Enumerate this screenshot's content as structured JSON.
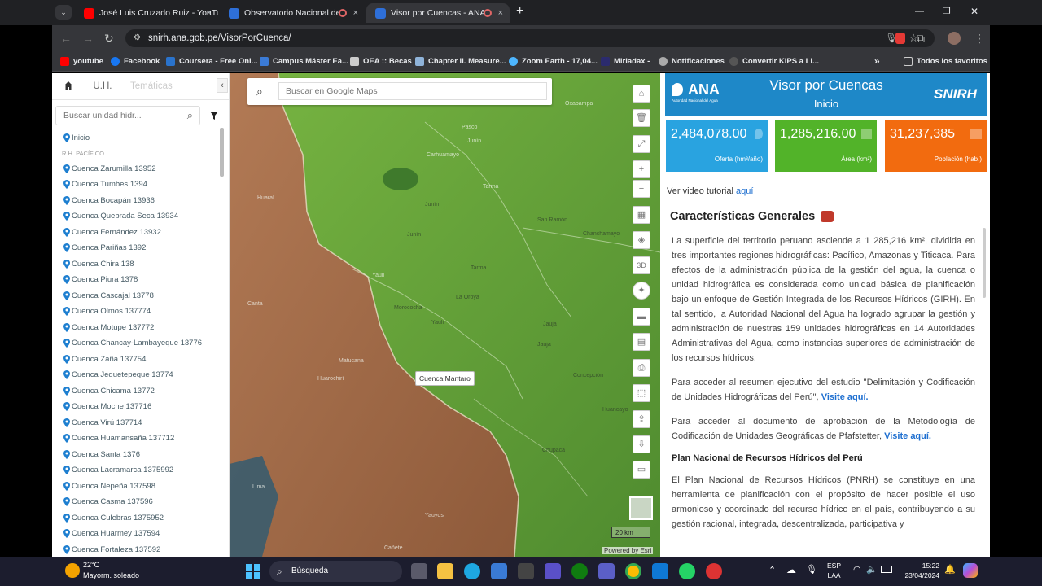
{
  "browser": {
    "tabs": [
      {
        "title": "José Luis Cruzado Ruiz - YouTu",
        "close": "×"
      },
      {
        "title": "Observatorio Nacional de",
        "close": "×"
      },
      {
        "title": "Visor por Cuencas - ANA",
        "close": "×"
      }
    ],
    "new_tab": "+",
    "window_controls": {
      "minimize": "—",
      "restore": "❐",
      "close": "✕"
    },
    "url": "snirh.ana.gob.pe/VisorPorCuenca/",
    "bookmarks": [
      {
        "label": "youtube",
        "color": "#ff0000"
      },
      {
        "label": "Facebook",
        "color": "#1877f2"
      },
      {
        "label": "Coursera - Free Onl...",
        "color": "#2a73cc"
      },
      {
        "label": "Campus Máster Ea...",
        "color": "#3b7bd6"
      },
      {
        "label": "OEA :: Becas",
        "color": "#cccccc"
      },
      {
        "label": "Chapter II. Measure...",
        "color": "#8fb3d9"
      },
      {
        "label": "Zoom Earth - 17,04...",
        "color": "#4db6ff"
      },
      {
        "label": "Miriadax -",
        "color": "#2b2b6e"
      },
      {
        "label": "Notificaciones",
        "color": "#aaaaaa"
      },
      {
        "label": "Convertir KIPS a Li...",
        "color": "#333333"
      }
    ],
    "more_bookmarks": "»",
    "all_favorites": "Todos los favoritos"
  },
  "left_panel": {
    "tab_uh": "U.H.",
    "tab_tematicas": "Temáticas",
    "collapse": "‹",
    "search_placeholder": "Buscar unidad hidr...",
    "start": "Inicio",
    "section": "R.H. PACÍFICO",
    "items": [
      "Cuenca Zarumilla 13952",
      "Cuenca Tumbes 1394",
      "Cuenca Bocapán 13936",
      "Cuenca Quebrada Seca 13934",
      "Cuenca Fernández 13932",
      "Cuenca Pariñas 1392",
      "Cuenca Chira 138",
      "Cuenca Piura 1378",
      "Cuenca Cascajal 13778",
      "Cuenca Olmos 137774",
      "Cuenca Motupe 137772",
      "Cuenca Chancay-Lambayeque 13776",
      "Cuenca Zaña 137754",
      "Cuenca Jequetepeque 13774",
      "Cuenca Chicama 13772",
      "Cuenca Moche 137716",
      "Cuenca Virú 137714",
      "Cuenca Huamansaña 137712",
      "Cuenca Santa 1376",
      "Cuenca Lacramarca 1375992",
      "Cuenca Nepeña 137598",
      "Cuenca Casma 137596",
      "Cuenca Culebras 1375952",
      "Cuenca Huarmey 137594",
      "Cuenca Fortaleza 137592"
    ]
  },
  "map": {
    "search_placeholder": "Buscar en Google Maps",
    "tooltip": "Cuenca Mantaro",
    "scale": "20 km",
    "attribution": "Powered by Esri",
    "tool_3d": "3D",
    "labels": [
      "Oxapampa",
      "Pasco",
      "Junín",
      "Carhuamayo",
      "Junín",
      "Junín",
      "Tarma",
      "Tarma",
      "San Ramón",
      "Chanchamayo",
      "Yauli",
      "Morococha",
      "La Oroya",
      "Yauli",
      "Jauja",
      "Jauja",
      "Matucana",
      "Huarochirí",
      "Concepción",
      "Huancayo",
      "Chupaca",
      "Huaral",
      "Canta",
      "Yauyos",
      "Cañete",
      "Lima"
    ]
  },
  "right_panel": {
    "logo_ana": "ANA",
    "logo_ana_sub": "Autoridad Nacional del Agua",
    "title": "Visor por Cuencas",
    "subtitle": "Inicio",
    "logo_snirh": "SNIRH",
    "stats": [
      {
        "value": "2,484,078.00",
        "label": "Oferta (hm³/año)",
        "color": "#29a3e0"
      },
      {
        "value": "1,285,216.00",
        "label": "Área (km²)",
        "color": "#52b329"
      },
      {
        "value": "31,237,385",
        "label": "Población (hab.)",
        "color": "#f26b0f"
      }
    ],
    "video_text": "Ver video tutorial",
    "video_link": "aquí",
    "section_title": "Características Generales",
    "p1": "La superficie del territorio peruano asciende a 1 285,216 km², dividida en tres importantes regiones hidrográficas: Pacífico, Amazonas y Titicaca. Para efectos de la administración pública de la gestión del agua, la cuenca o unidad hidrográfica es considerada como unidad básica de planificación bajo un enfoque de Gestión Integrada de los Recursos Hídricos (GIRH). En tal sentido, la Autoridad Nacional del Agua ha logrado agrupar la gestión y administración de nuestras 159 unidades hidrográficas en 14 Autoridades Administrativas del Agua, como instancias superiores de administración de los recursos hídricos.",
    "p2": "Para acceder al resumen ejecutivo del estudio \"Delimitación y Codificación de Unidades Hidrográficas del Perú\",",
    "p2_link": "Visite aquí.",
    "p3": "Para acceder al documento de aprobación de la Metodología de Codificación de Unidades Geográficas de Pfafstetter,",
    "p3_link": "Visite aquí.",
    "plan_title": "Plan Nacional de Recursos Hídricos del Perú",
    "p4": "El Plan Nacional de Recursos Hídricos (PNRH) se constituye en una herramienta de planificación con el propósito de hacer posible el uso armonioso y coordinado del recurso hídrico en el país, contribuyendo a su gestión racional, integrada, descentralizada, participativa y"
  },
  "taskbar": {
    "temp": "22°C",
    "weather": "Mayorm. soleado",
    "search": "Búsqueda",
    "lang1": "ESP",
    "lang2": "LAA",
    "time": "15:22",
    "date": "23/04/2024"
  }
}
